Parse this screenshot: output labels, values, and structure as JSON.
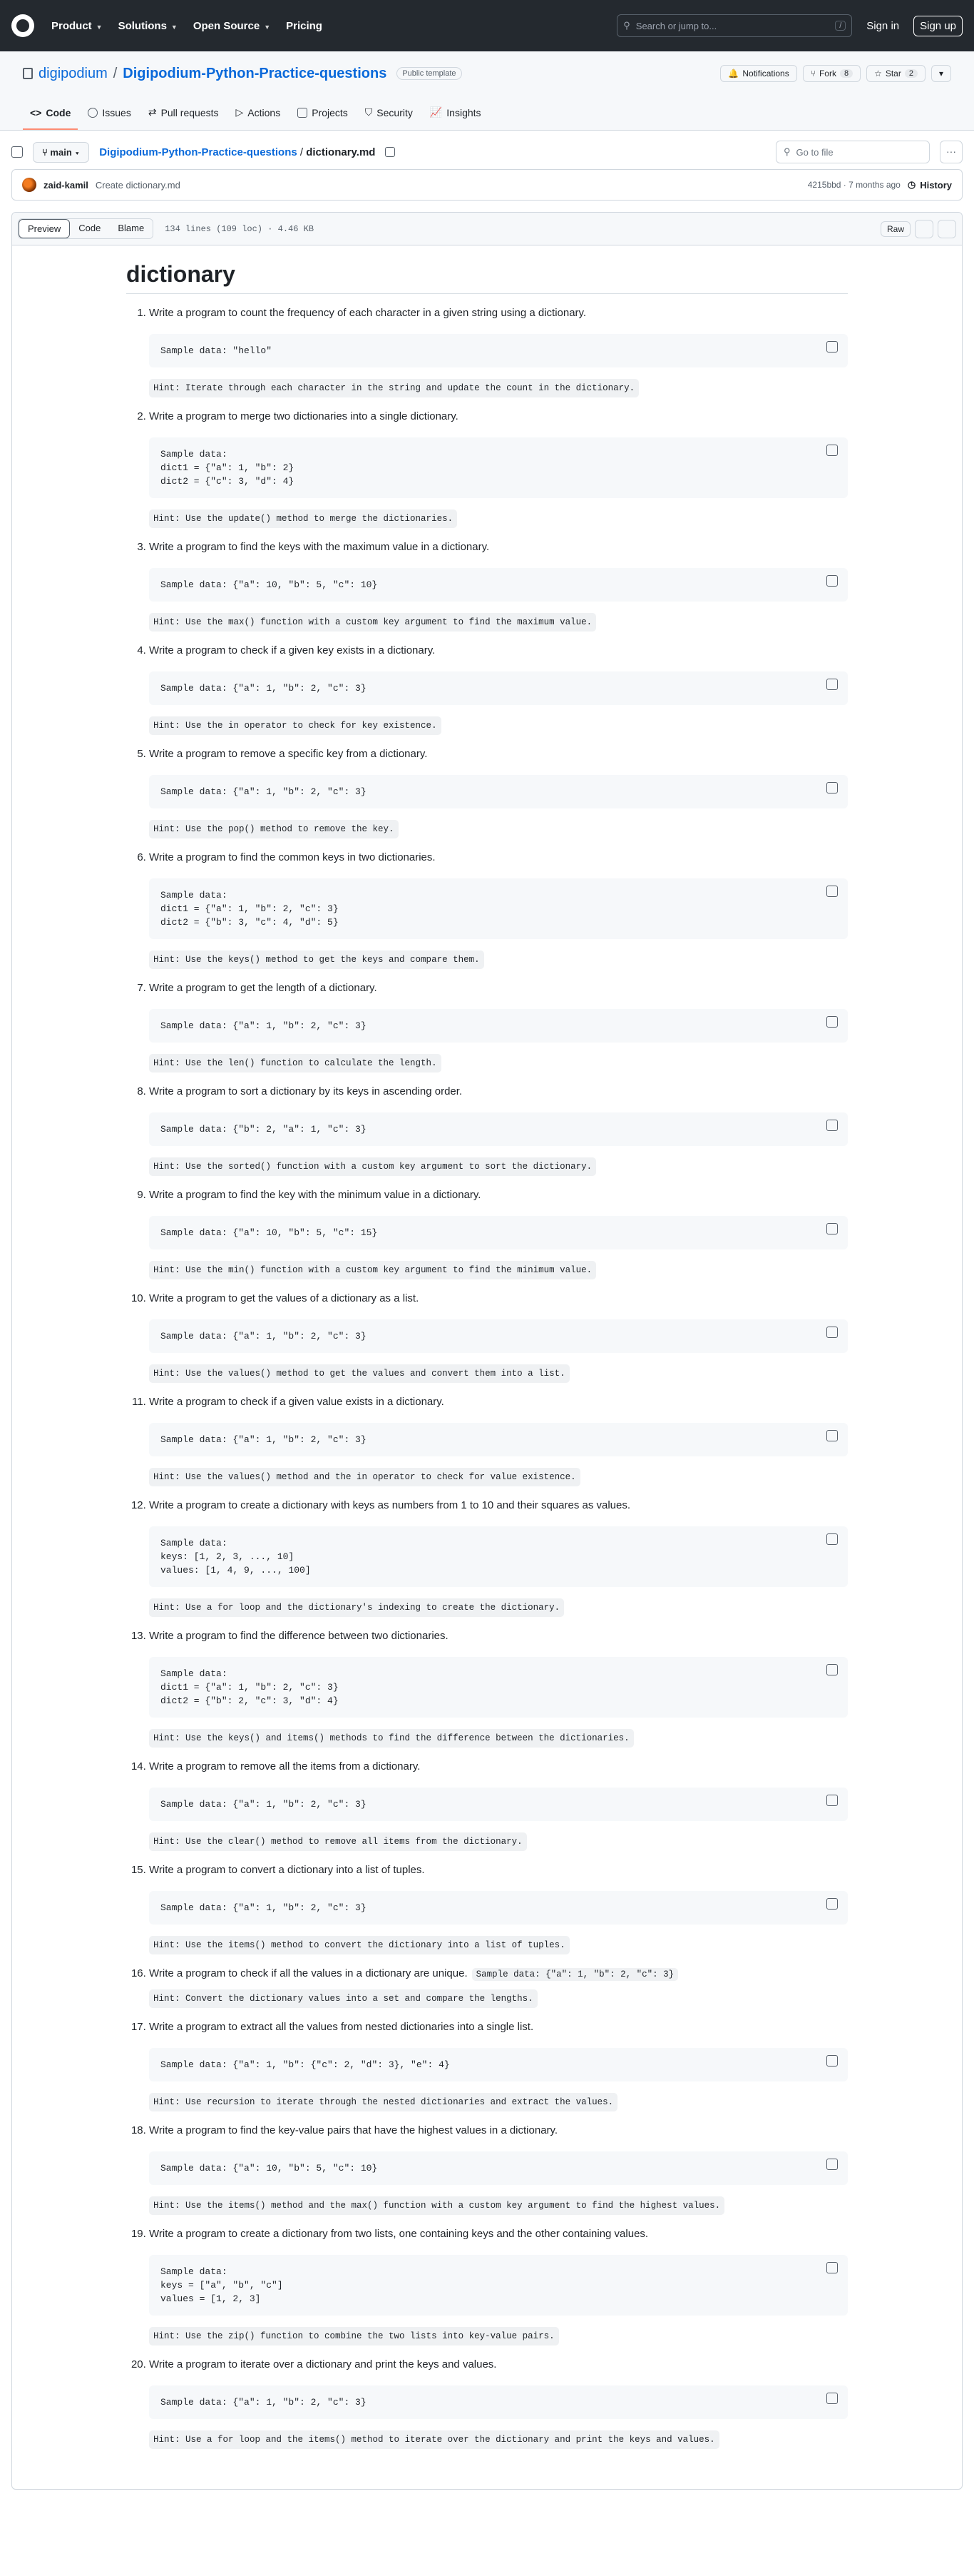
{
  "header": {
    "nav": [
      "Product",
      "Solutions",
      "Open Source",
      "Pricing"
    ],
    "search_placeholder": "Search or jump to...",
    "search_key": "/",
    "sign_in": "Sign in",
    "sign_up": "Sign up"
  },
  "repo": {
    "owner": "digipodium",
    "separator": "/",
    "name": "Digipodium-Python-Practice-questions",
    "visibility": "Public template",
    "notifications": "Notifications",
    "fork": "Fork",
    "fork_count": "8",
    "star": "Star",
    "star_count": "2",
    "tabs": [
      "Code",
      "Issues",
      "Pull requests",
      "Actions",
      "Projects",
      "Security",
      "Insights"
    ]
  },
  "file": {
    "branch": "main",
    "repo_crumb": "Digipodium-Python-Practice-questions",
    "crumb_sep": "/",
    "filename": "dictionary.md",
    "goto_placeholder": "Go to file",
    "commit_author": "zaid-kamil",
    "commit_msg": "Create dictionary.md",
    "commit_meta": "4215bbd · 7 months ago",
    "history": "History",
    "view_tabs": [
      "Preview",
      "Code",
      "Blame"
    ],
    "info": "134 lines (109 loc) · 4.46 KB",
    "raw": "Raw"
  },
  "doc": {
    "title": "dictionary",
    "items": [
      {
        "q": "Write a program to count the frequency of each character in a given string using a dictionary.",
        "code": "Sample data: \"hello\"",
        "hint": "Hint: Iterate through each character in the string and update the count in the dictionary."
      },
      {
        "q": "Write a program to merge two dictionaries into a single dictionary.",
        "code": "Sample data:\ndict1 = {\"a\": 1, \"b\": 2}\ndict2 = {\"c\": 3, \"d\": 4}",
        "hint": "Hint: Use the update() method to merge the dictionaries."
      },
      {
        "q": "Write a program to find the keys with the maximum value in a dictionary.",
        "code": "Sample data: {\"a\": 10, \"b\": 5, \"c\": 10}",
        "hint": "Hint: Use the max() function with a custom key argument to find the maximum value."
      },
      {
        "q": "Write a program to check if a given key exists in a dictionary.",
        "code": "Sample data: {\"a\": 1, \"b\": 2, \"c\": 3}",
        "hint": "Hint: Use the in operator to check for key existence."
      },
      {
        "q": "Write a program to remove a specific key from a dictionary.",
        "code": "Sample data: {\"a\": 1, \"b\": 2, \"c\": 3}",
        "hint": "Hint: Use the pop() method to remove the key."
      },
      {
        "q": "Write a program to find the common keys in two dictionaries.",
        "code": "Sample data:\ndict1 = {\"a\": 1, \"b\": 2, \"c\": 3}\ndict2 = {\"b\": 3, \"c\": 4, \"d\": 5}",
        "hint": "Hint: Use the keys() method to get the keys and compare them."
      },
      {
        "q": "Write a program to get the length of a dictionary.",
        "code": "Sample data: {\"a\": 1, \"b\": 2, \"c\": 3}",
        "hint": "Hint: Use the len() function to calculate the length."
      },
      {
        "q": "Write a program to sort a dictionary by its keys in ascending order.",
        "code": "Sample data: {\"b\": 2, \"a\": 1, \"c\": 3}",
        "hint": "Hint: Use the sorted() function with a custom key argument to sort the dictionary."
      },
      {
        "q": "Write a program to find the key with the minimum value in a dictionary.",
        "code": "Sample data: {\"a\": 10, \"b\": 5, \"c\": 15}",
        "hint": "Hint: Use the min() function with a custom key argument to find the minimum value."
      },
      {
        "q": "Write a program to get the values of a dictionary as a list.",
        "code": "Sample data: {\"a\": 1, \"b\": 2, \"c\": 3}",
        "hint": "Hint: Use the values() method to get the values and convert them into a list."
      },
      {
        "q": "Write a program to check if a given value exists in a dictionary.",
        "code": "Sample data: {\"a\": 1, \"b\": 2, \"c\": 3}",
        "hint": "Hint: Use the values() method and the in operator to check for value existence."
      },
      {
        "q": "Write a program to create a dictionary with keys as numbers from 1 to 10 and their squares as values.",
        "code": "Sample data:\nkeys: [1, 2, 3, ..., 10]\nvalues: [1, 4, 9, ..., 100]",
        "hint": "Hint: Use a for loop and the dictionary's indexing to create the dictionary."
      },
      {
        "q": "Write a program to find the difference between two dictionaries.",
        "code": "Sample data:\ndict1 = {\"a\": 1, \"b\": 2, \"c\": 3}\ndict2 = {\"b\": 2, \"c\": 3, \"d\": 4}",
        "hint": "Hint: Use the keys() and items() methods to find the difference between the dictionaries."
      },
      {
        "q": "Write a program to remove all the items from a dictionary.",
        "code": "Sample data: {\"a\": 1, \"b\": 2, \"c\": 3}",
        "hint": "Hint: Use the clear() method to remove all items from the dictionary."
      },
      {
        "q": "Write a program to convert a dictionary into a list of tuples.",
        "code": "Sample data: {\"a\": 1, \"b\": 2, \"c\": 3}",
        "hint": "Hint: Use the items() method to convert the dictionary into a list of tuples."
      },
      {
        "q": "Write a program to check if all the values in a dictionary are unique.",
        "inline": "Sample data: {\"a\": 1, \"b\": 2, \"c\": 3}",
        "hint": "Hint: Convert the dictionary values into a set and compare the lengths."
      },
      {
        "q": "Write a program to extract all the values from nested dictionaries into a single list.",
        "code": "Sample data: {\"a\": 1, \"b\": {\"c\": 2, \"d\": 3}, \"e\": 4}",
        "hint": "Hint: Use recursion to iterate through the nested dictionaries and extract the values."
      },
      {
        "q": "Write a program to find the key-value pairs that have the highest values in a dictionary.",
        "code": "Sample data: {\"a\": 10, \"b\": 5, \"c\": 10}",
        "hint": "Hint: Use the items() method and the max() function with a custom key argument to find the highest values."
      },
      {
        "q": "Write a program to create a dictionary from two lists, one containing keys and the other containing values.",
        "code": "Sample data:\nkeys = [\"a\", \"b\", \"c\"]\nvalues = [1, 2, 3]",
        "hint": "Hint: Use the zip() function to combine the two lists into key-value pairs."
      },
      {
        "q": "Write a program to iterate over a dictionary and print the keys and values.",
        "code": "Sample data: {\"a\": 1, \"b\": 2, \"c\": 3}",
        "hint": "Hint: Use a for loop and the items() method to iterate over the dictionary and print the keys and values."
      }
    ]
  }
}
